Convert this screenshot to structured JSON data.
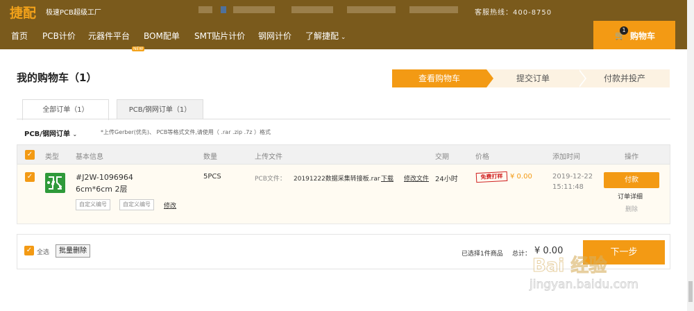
{
  "brand": {
    "logo": "捷配",
    "slogan": "极速PCB超级工厂",
    "hotline_partial": "客服热线：400-8750"
  },
  "nav": {
    "items": [
      "首页",
      "PCB计价",
      "元器件平台",
      "BOM配单",
      "SMT贴片计价",
      "钢网计价",
      "了解捷配"
    ],
    "new_badge": "NEW",
    "cart_label": "购物车",
    "cart_count": "1"
  },
  "page": {
    "title": "我的购物车（1）"
  },
  "steps": [
    "查看购物车",
    "提交订单",
    "付款并投产"
  ],
  "tabs": [
    "全部订单（1）",
    "PCB/钢网订单（1）"
  ],
  "filter": {
    "label": "PCB/钢网订单",
    "hint": "*上传Gerber(优先)、 PCB等格式文件,请使用（ .rar .zip .7z ）格式"
  },
  "table": {
    "headers": [
      "类型",
      "基本信息",
      "数量",
      "上传文件",
      "交期",
      "价格",
      "添加时间",
      "操作"
    ],
    "rows": [
      {
        "order_no": "#J2W-1096964",
        "spec": "6cm*6cm 2层",
        "tag1": "自定义编号",
        "tag2": "自定义编号",
        "edit": "修改",
        "qty": "5PCS",
        "file_label": "PCB文件：",
        "file_name": "20191222数据采集转接板.rar",
        "download": "下载",
        "change_file": "修改文件",
        "lead": "24小时",
        "free": "免费打样",
        "price": "¥ 0.00",
        "date": "2019-12-22",
        "time": "15:11:48",
        "pay": "付款",
        "detail": "订单详细",
        "delete": "删除"
      }
    ]
  },
  "footer": {
    "select_all": "全选",
    "batch_delete": "批量删除",
    "selected": "已选择1件商品",
    "total_label": "总计：",
    "total": "¥ 0.00",
    "next": "下一步"
  },
  "watermark": {
    "text": "Bai 经验",
    "url": "jingyan.baidu.com"
  },
  "colors": {
    "brand_brown": "#7a5a1c",
    "accent_orange": "#f39a14"
  }
}
